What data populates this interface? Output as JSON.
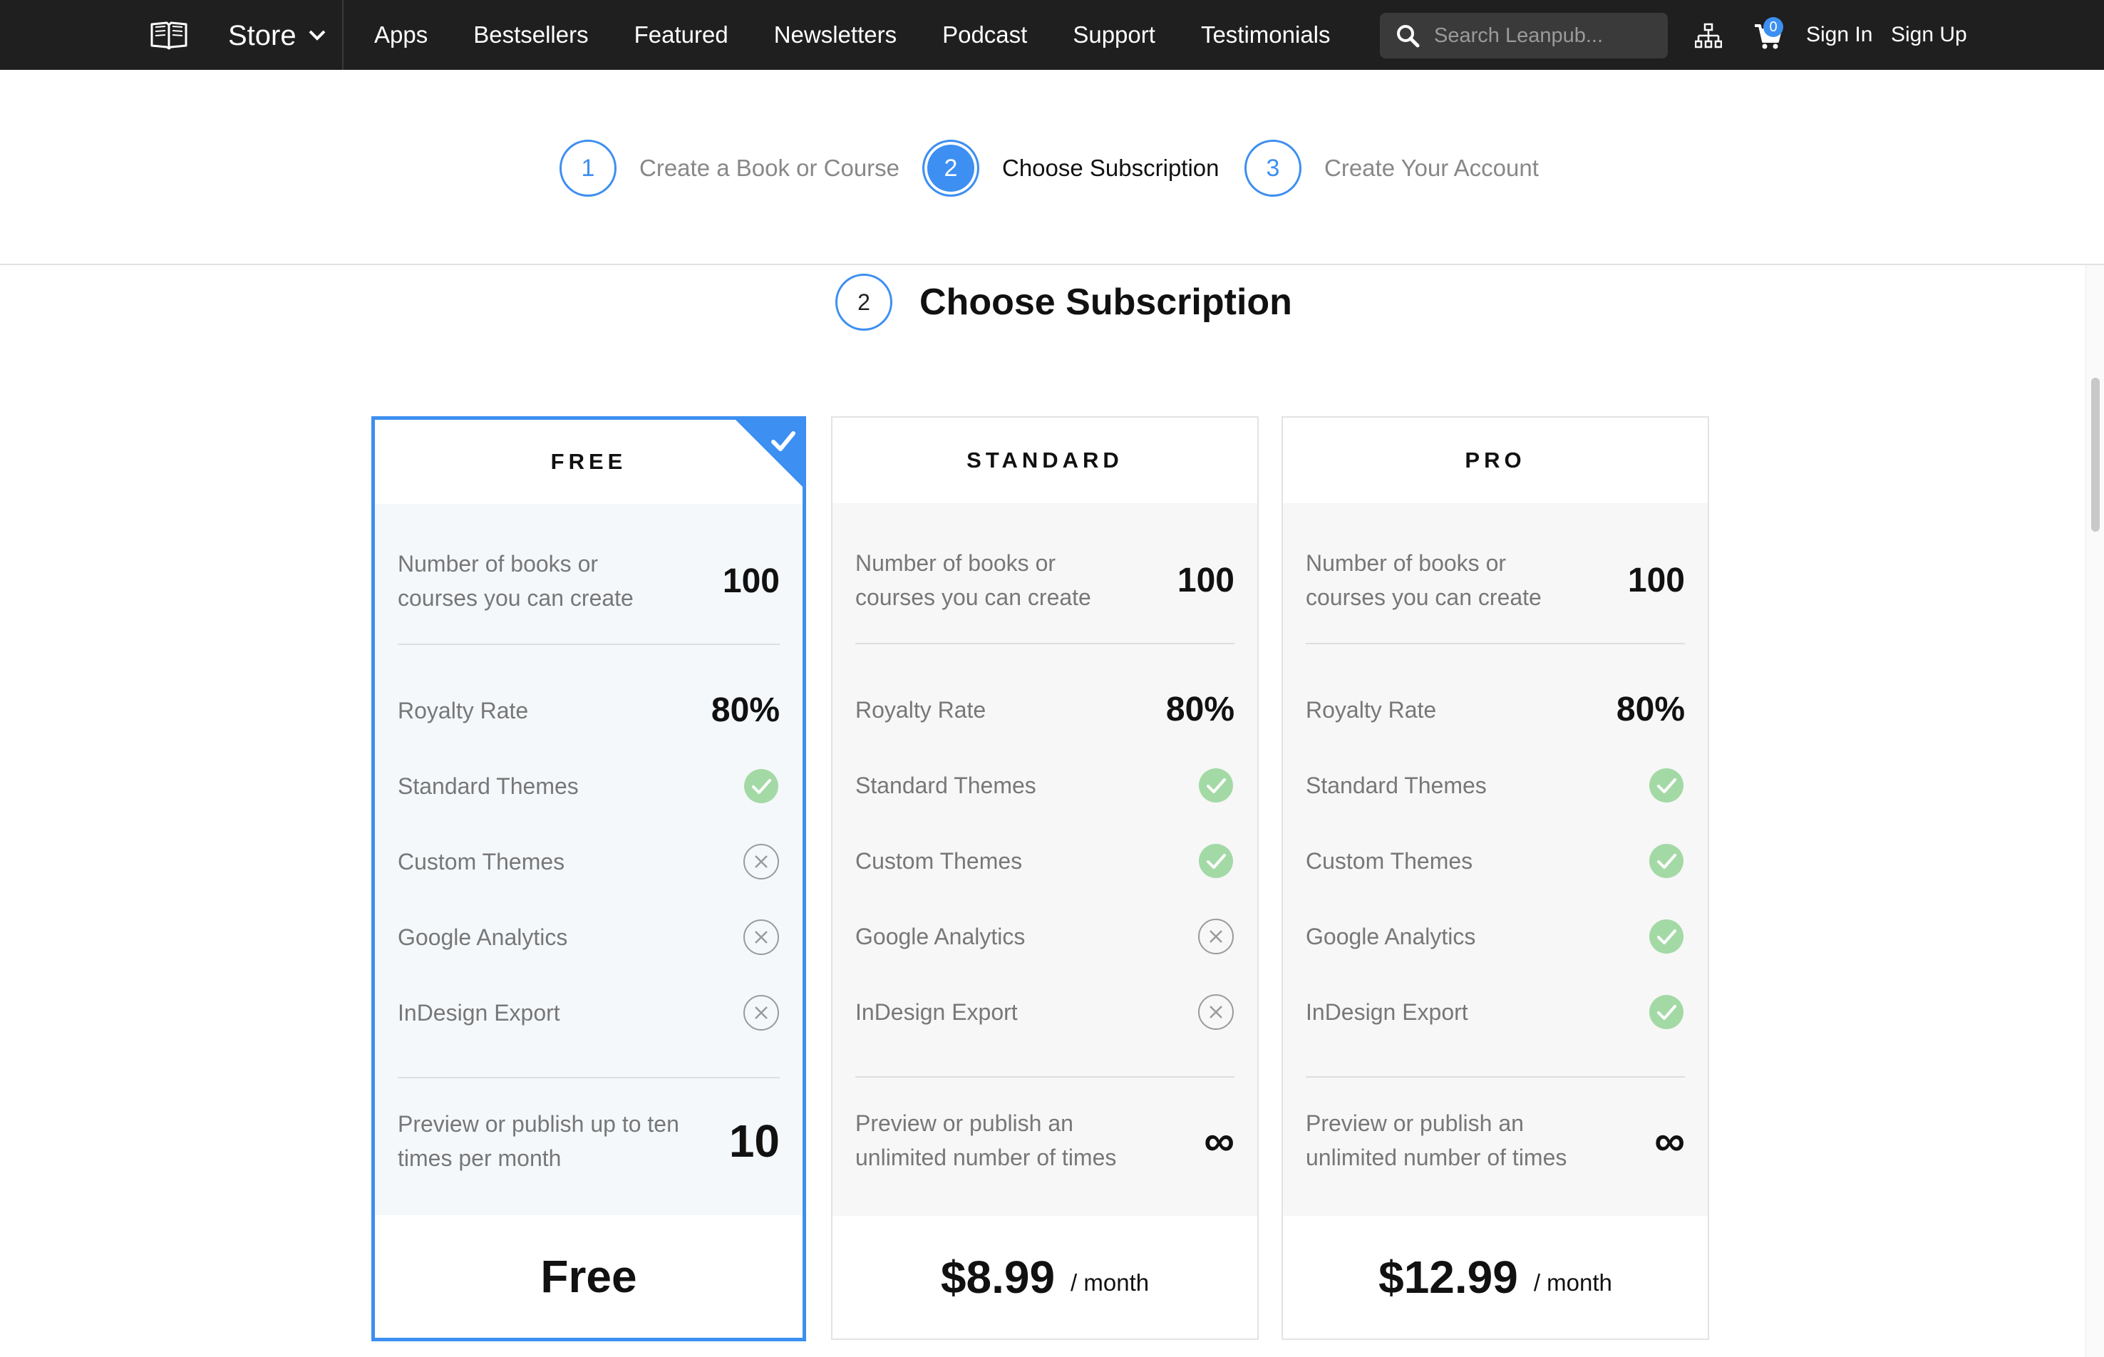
{
  "nav": {
    "store_label": "Store",
    "links": [
      "Apps",
      "Bestsellers",
      "Featured",
      "Newsletters",
      "Podcast",
      "Support",
      "Testimonials"
    ],
    "search_placeholder": "Search Leanpub...",
    "cart_count": "0",
    "sign_in": "Sign In",
    "sign_up": "Sign Up"
  },
  "stepper": {
    "steps": [
      {
        "number": "1",
        "label": "Create a Book or Course",
        "active": false
      },
      {
        "number": "2",
        "label": "Choose Subscription",
        "active": true
      },
      {
        "number": "3",
        "label": "Create Your Account",
        "active": false
      }
    ]
  },
  "section": {
    "number": "2",
    "title": "Choose Subscription"
  },
  "plans": [
    {
      "name": "FREE",
      "selected": true,
      "books_label": "Number of books or courses you can create",
      "books_value": "100",
      "royalty_label": "Royalty Rate",
      "royalty_value": "80%",
      "features": [
        {
          "label": "Standard Themes",
          "included": true
        },
        {
          "label": "Custom Themes",
          "included": false
        },
        {
          "label": "Google Analytics",
          "included": false
        },
        {
          "label": "InDesign Export",
          "included": false
        }
      ],
      "publish_label": "Preview or publish up to ten times per month",
      "publish_value": "10",
      "price": "Free",
      "period": ""
    },
    {
      "name": "STANDARD",
      "selected": false,
      "books_label": "Number of books or courses you can create",
      "books_value": "100",
      "royalty_label": "Royalty Rate",
      "royalty_value": "80%",
      "features": [
        {
          "label": "Standard Themes",
          "included": true
        },
        {
          "label": "Custom Themes",
          "included": true
        },
        {
          "label": "Google Analytics",
          "included": false
        },
        {
          "label": "InDesign Export",
          "included": false
        }
      ],
      "publish_label": "Preview or publish an unlimited number of times",
      "publish_value": "∞",
      "price": "$8.99",
      "period": "/ month"
    },
    {
      "name": "PRO",
      "selected": false,
      "books_label": "Number of books or courses you can create",
      "books_value": "100",
      "royalty_label": "Royalty Rate",
      "royalty_value": "80%",
      "features": [
        {
          "label": "Standard Themes",
          "included": true
        },
        {
          "label": "Custom Themes",
          "included": true
        },
        {
          "label": "Google Analytics",
          "included": true
        },
        {
          "label": "InDesign Export",
          "included": true
        }
      ],
      "publish_label": "Preview or publish an unlimited number of times",
      "publish_value": "∞",
      "price": "$12.99",
      "period": "/ month"
    }
  ],
  "icons": {
    "logo": "open-book-icon",
    "store_chevron": "chevron-down-icon",
    "search": "search-icon",
    "sitemap": "sitemap-icon",
    "cart": "cart-icon",
    "included": "check-circle-icon",
    "excluded": "x-circle-icon",
    "selected": "checkmark-ribbon-icon"
  },
  "colors": {
    "accent": "#3d8ff1",
    "nav_bg": "#1f1f1f",
    "check_green": "#a3d9a5",
    "x_gray": "#9a9a9a"
  }
}
